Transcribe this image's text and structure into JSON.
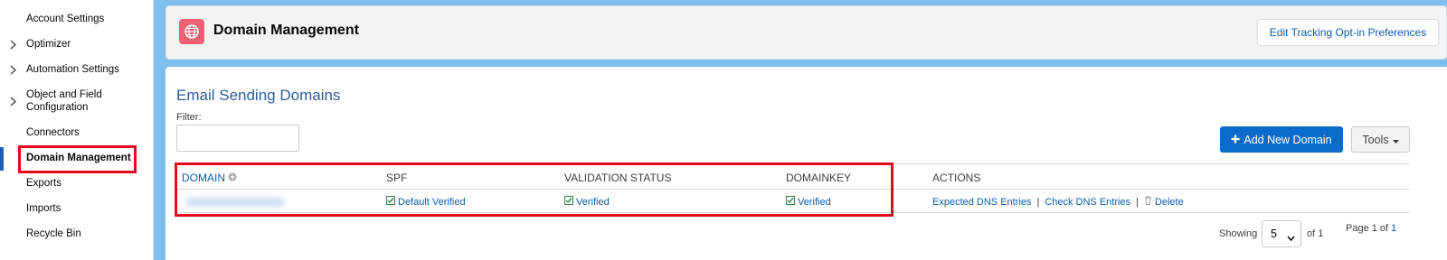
{
  "sidebar": {
    "items": [
      {
        "label": "Account Settings",
        "expandable": false
      },
      {
        "label": "Optimizer",
        "expandable": true
      },
      {
        "label": "Automation Settings",
        "expandable": true
      },
      {
        "label": "Object and Field Configuration",
        "expandable": true
      },
      {
        "label": "Connectors",
        "expandable": false
      },
      {
        "label": "Domain Management",
        "expandable": false,
        "active": true
      },
      {
        "label": "Exports",
        "expandable": false
      },
      {
        "label": "Imports",
        "expandable": false
      },
      {
        "label": "Recycle Bin",
        "expandable": false
      }
    ]
  },
  "header": {
    "icon": "globe-icon",
    "title": "Domain Management",
    "opt_in_button": "Edit Tracking Opt-in Preferences"
  },
  "main": {
    "section_title": "Email Sending Domains",
    "filter_label": "Filter:",
    "filter_value": "",
    "add_button": "Add New Domain",
    "tools_button": "Tools",
    "table": {
      "columns": [
        "DOMAIN",
        "SPF",
        "VALIDATION STATUS",
        "DOMAINKEY",
        "ACTIONS"
      ],
      "rows": [
        {
          "domain": "",
          "spf": "Default Verified",
          "validation_status": "Verified",
          "domainkey": "Verified",
          "actions": [
            "Expected DNS Entries",
            "Check DNS Entries",
            "Delete"
          ]
        }
      ]
    },
    "pagination": {
      "showing_label": "Showing",
      "page_size": "5",
      "of_label": "of 1",
      "page_label": "Page 1 of",
      "total_pages": "1"
    }
  },
  "colors": {
    "accent": "#0b6bcb",
    "link": "#0b5cab",
    "highlight": "#e4081c",
    "app_icon": "#f06273",
    "page_background": "#7fbff0"
  }
}
